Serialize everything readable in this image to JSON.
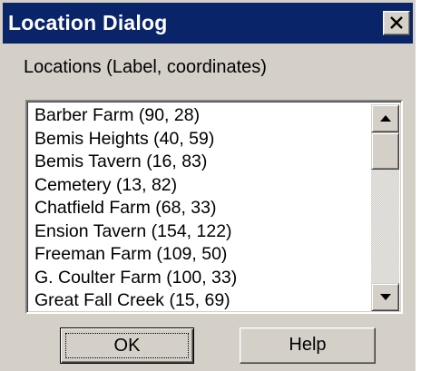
{
  "dialog": {
    "title": "Location Dialog",
    "close_icon": "close-x-icon"
  },
  "list_label": "Locations (Label, coordinates)",
  "locations": [
    "Barber Farm (90, 28)",
    "Bemis Heights (40, 59)",
    "Bemis Tavern (16, 83)",
    "Cemetery (13, 82)",
    "Chatfield Farm (68, 33)",
    "Ension Tavern (154, 122)",
    "Freeman Farm (109, 50)",
    "G. Coulter Farm (100, 33)",
    "Great Fall Creek (15, 69)"
  ],
  "scrollbar": {
    "up_icon": "arrow-up-icon",
    "down_icon": "arrow-down-icon"
  },
  "buttons": {
    "ok_label": "OK",
    "help_label": "Help"
  },
  "colors": {
    "titlebar": "#0a246a",
    "face": "#d4d0c8"
  }
}
